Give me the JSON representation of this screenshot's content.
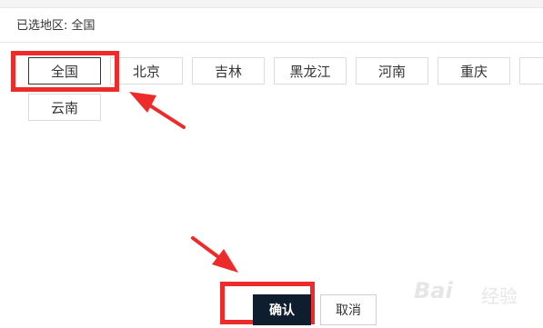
{
  "header": {
    "selected_label": "已选地区",
    "selected_separator": ": ",
    "selected_value": "全国"
  },
  "regions": {
    "items": [
      {
        "label": "全国",
        "active": true
      },
      {
        "label": "北京",
        "active": false
      },
      {
        "label": "吉林",
        "active": false
      },
      {
        "label": "黑龙江",
        "active": false
      },
      {
        "label": "河南",
        "active": false
      },
      {
        "label": "重庆",
        "active": false
      },
      {
        "label": "云南",
        "active": false
      }
    ]
  },
  "footer": {
    "confirm_label": "确认",
    "cancel_label": "取消"
  },
  "watermark": {
    "brand": "Bai",
    "suffix": "经验"
  },
  "colors": {
    "annotation": "#ee2b2b",
    "confirm_bg": "#0f1e2f",
    "active_border": "#333333"
  }
}
